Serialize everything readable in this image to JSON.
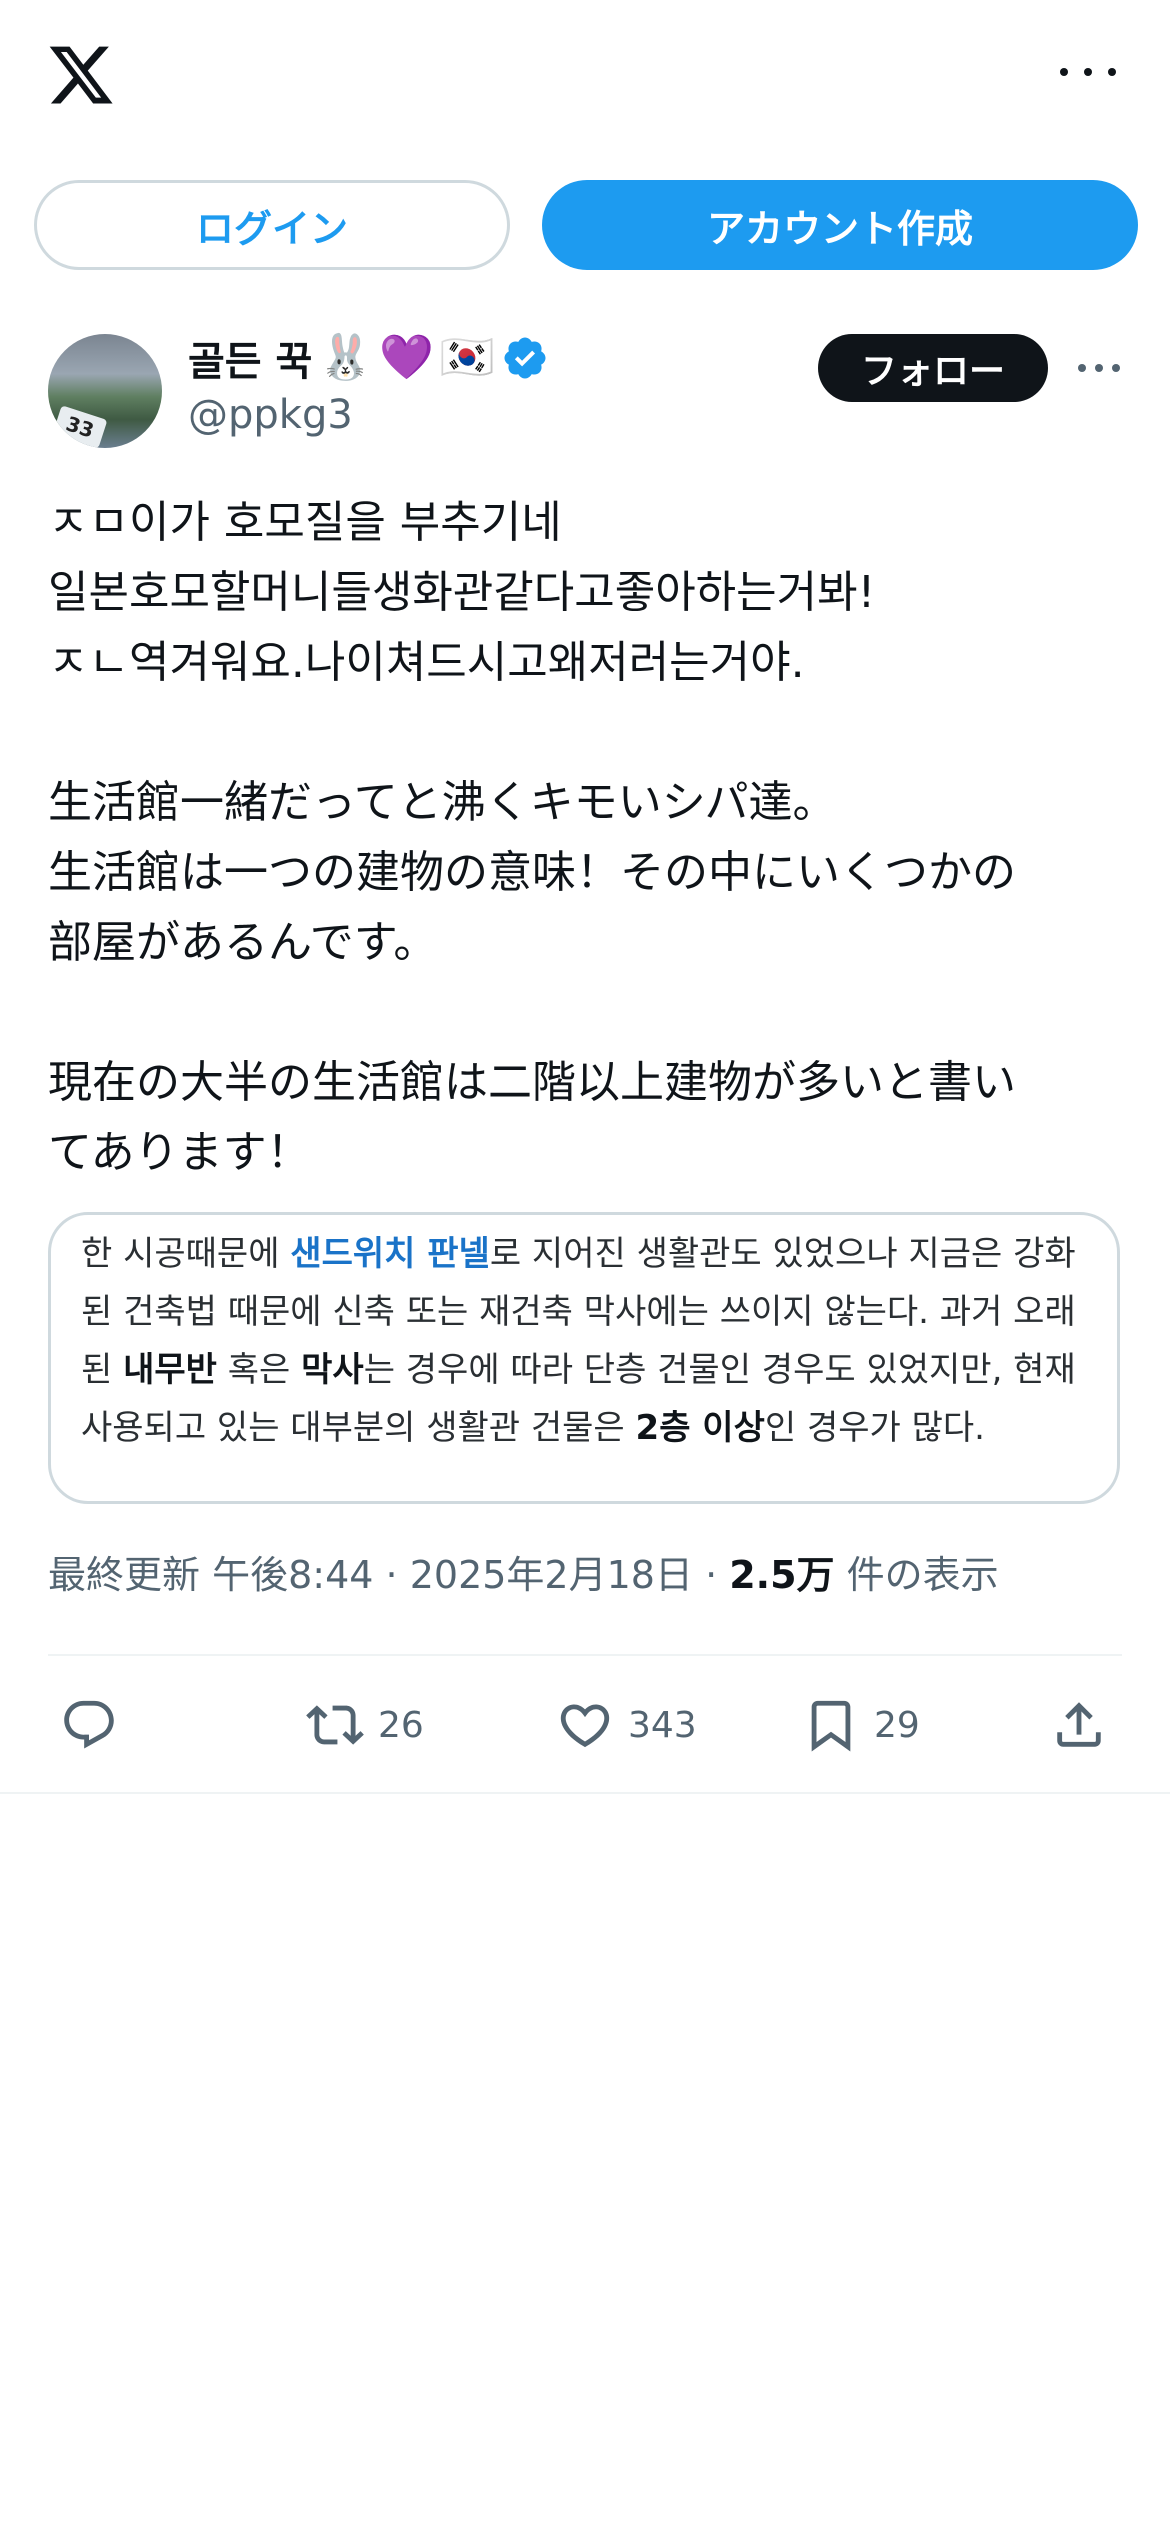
{
  "header": {
    "logo_icon": "x-logo-icon",
    "more_icon": "more-horizontal-icon"
  },
  "auth": {
    "login_label": "ログイン",
    "signup_label": "アカウント作成"
  },
  "tweet": {
    "author": {
      "name": "골든 꾹",
      "emojis": [
        "🐰",
        "💜",
        "🇰🇷"
      ],
      "handle": "@ppkg3",
      "verified": true,
      "avatar_sign_text": "33"
    },
    "follow_label": "フォロー",
    "text": "ㅈㅁ이가 호모질을 부추기네\n일본호모할머니들생화관같다고좋아하는거봐!\nㅈㄴ역겨워요.나이쳐드시고왜저러는거야.\n\n生活館一緒だってと沸くキモいシパ達。\n生活館は一つの建物の意味！その中にいくつかの\n部屋があるんです。\n\n現在の大半の生活館は二階以上建物が多いと書い\nてあります！",
    "quote_card": {
      "seg1": "한 시공때문에 ",
      "link": "샌드위치 판넬",
      "seg2": "로 지어진 생활관도 있었으나 지금은 강화된 건축법 때문에 신축 또는 재건축 막사에는 쓰이지 않는다. 과거 오래된 ",
      "bold1": "내무반",
      "seg3": " 혹은 ",
      "bold2": "막사",
      "seg4": "는 경우에 따라 단층 건물인 경우도 있었지만, 현재 사용되고 있는 대부분의 생활관 건물은 ",
      "bold3": "2층 이상",
      "seg5": "인 경우가 많다."
    },
    "meta": {
      "updated_label": "最終更新",
      "time": "午後8:44",
      "date": "2025年2月18日",
      "views_count": "2.5万",
      "views_label": "件の表示"
    },
    "actions": {
      "reply_icon": "reply-icon",
      "retweet_count": "26",
      "like_count": "343",
      "bookmark_count": "29",
      "share_icon": "share-icon"
    }
  },
  "colors": {
    "accent": "#1d9bf0",
    "text": "#0f1419",
    "secondary": "#536471",
    "border": "#cfd9de"
  }
}
